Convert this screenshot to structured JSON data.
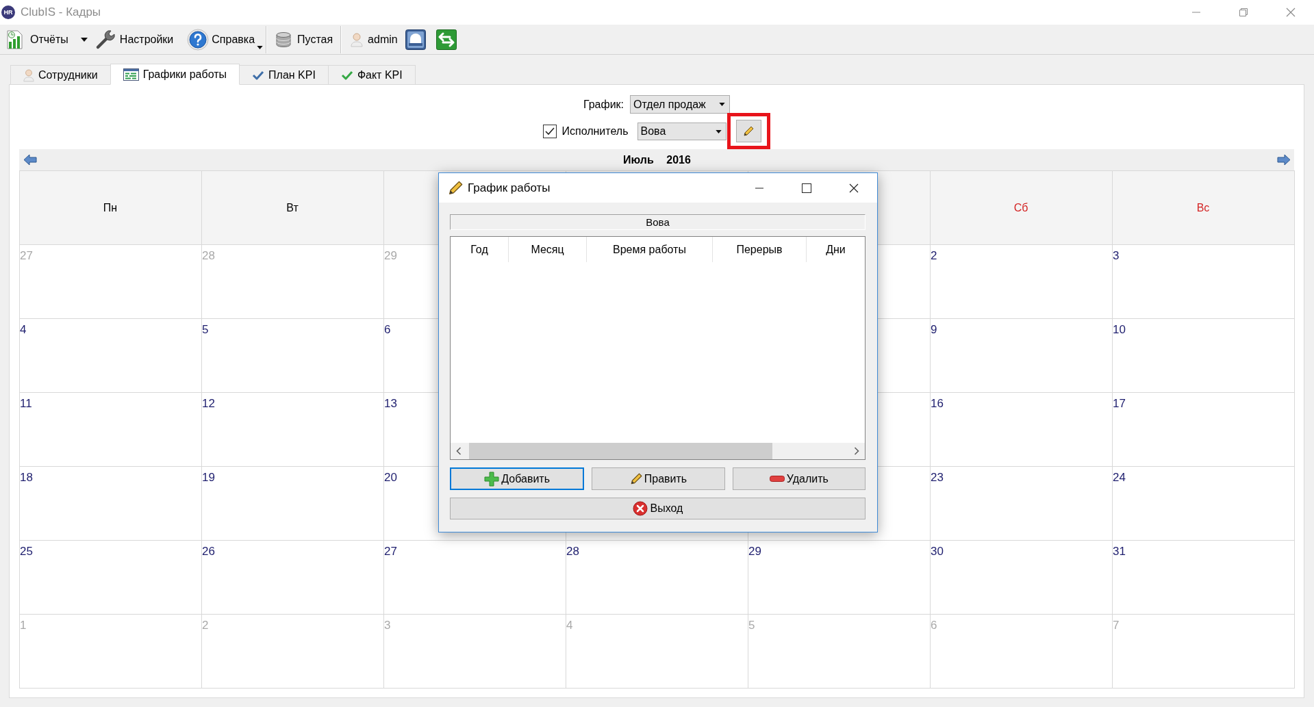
{
  "window": {
    "logo": "HR",
    "title": "ClubIS - Кадры"
  },
  "toolbar": {
    "reports": {
      "label": "Отчёты"
    },
    "settings": {
      "label": "Настройки"
    },
    "help": {
      "label": "Справка"
    },
    "database": {
      "label": "Пустая"
    },
    "user": {
      "label": "admin"
    }
  },
  "tabs": [
    {
      "label": "Сотрудники",
      "selected": false
    },
    {
      "label": "Графики работы",
      "selected": true
    },
    {
      "label": "План KPI",
      "selected": false
    },
    {
      "label": "Факт KPI",
      "selected": false
    }
  ],
  "filters": {
    "schedule": {
      "label": "График:",
      "value": "Отдел продаж"
    },
    "performer": {
      "label": "Исполнитель",
      "checked": true,
      "value": "Вова",
      "edit_highlighted": true
    }
  },
  "calendar": {
    "month": "Июль 2016",
    "weekdays": {
      "left": [
        {
          "label": "Пн",
          "weekend": false
        },
        {
          "label": "Вт",
          "weekend": false
        }
      ],
      "right": [
        {
          "label": "Сб",
          "weekend": true
        },
        {
          "label": "Вс",
          "weekend": true
        }
      ]
    },
    "weeks": [
      {
        "left": [
          {
            "day": "27",
            "in_month": false
          },
          {
            "day": "28",
            "in_month": false
          },
          {
            "day": "29",
            "in_month": false
          }
        ],
        "right": [
          {
            "day": "2",
            "in_month": true
          },
          {
            "day": "3",
            "in_month": true
          }
        ]
      },
      {
        "left": [
          {
            "day": "4",
            "in_month": true
          },
          {
            "day": "5",
            "in_month": true
          },
          {
            "day": "6",
            "in_month": true
          }
        ],
        "right": [
          {
            "day": "9",
            "in_month": true
          },
          {
            "day": "10",
            "in_month": true
          }
        ]
      },
      {
        "left": [
          {
            "day": "11",
            "in_month": true
          },
          {
            "day": "12",
            "in_month": true
          },
          {
            "day": "13",
            "in_month": true
          }
        ],
        "right": [
          {
            "day": "16",
            "in_month": true
          },
          {
            "day": "17",
            "in_month": true
          }
        ]
      },
      {
        "left": [
          {
            "day": "18",
            "in_month": true
          },
          {
            "day": "19",
            "in_month": true
          },
          {
            "day": "20",
            "in_month": true
          }
        ],
        "right": [
          {
            "day": "23",
            "in_month": true
          },
          {
            "day": "24",
            "in_month": true
          }
        ]
      },
      {
        "left": [
          {
            "day": "25",
            "in_month": true
          },
          {
            "day": "26",
            "in_month": true
          },
          {
            "day": "27",
            "in_month": true
          },
          {
            "day": "28",
            "in_month": true
          },
          {
            "day": "29",
            "in_month": true
          },
          {
            "day": "30",
            "in_month": true
          },
          {
            "day": "31",
            "in_month": true
          }
        ]
      },
      {
        "left": [
          {
            "day": "1",
            "in_month": false
          },
          {
            "day": "2",
            "in_month": false
          },
          {
            "day": "3",
            "in_month": false
          },
          {
            "day": "4",
            "in_month": false
          },
          {
            "day": "5",
            "in_month": false
          },
          {
            "day": "6",
            "in_month": false
          },
          {
            "day": "7",
            "in_month": false
          }
        ]
      }
    ]
  },
  "dialog": {
    "title": "График работы",
    "person": "Вова",
    "columns": [
      "Год",
      "Месяц",
      "Время работы",
      "Перерыв",
      "Дни"
    ],
    "buttons": [
      {
        "label": "Добавить",
        "focused": true
      },
      {
        "label": "Править",
        "focused": false
      },
      {
        "label": "Удалить",
        "focused": false
      }
    ],
    "exit": {
      "label": "Выход"
    }
  }
}
